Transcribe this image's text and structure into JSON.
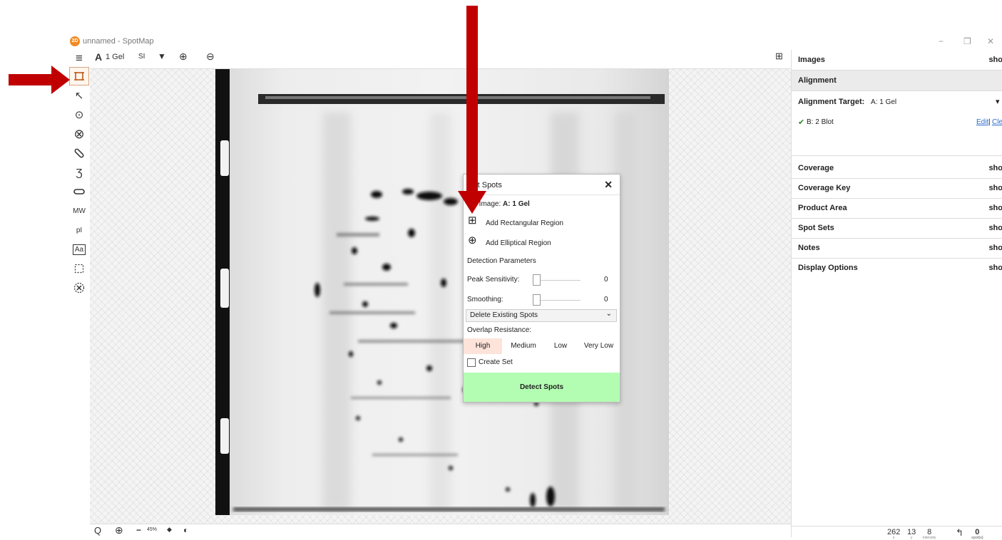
{
  "window": {
    "title": "unnamed - SpotMap",
    "app_icon_text": "2D",
    "controls": [
      "−",
      "❐",
      "✕"
    ]
  },
  "left_toolbar": {
    "items": [
      {
        "name": "rectangle-select-icon",
        "glyph": "⌑",
        "selected": true
      },
      {
        "name": "pointer-icon",
        "glyph": "↖"
      },
      {
        "name": "add-spot-icon",
        "glyph": "⊙"
      },
      {
        "name": "remove-spot-icon",
        "glyph": "⊗"
      },
      {
        "name": "link-icon",
        "glyph": "⊘"
      },
      {
        "name": "freeform-icon",
        "glyph": "Ʒ"
      },
      {
        "name": "band-icon",
        "glyph": "▭"
      },
      {
        "name": "mw-tool",
        "glyph": "MW"
      },
      {
        "name": "pi-tool",
        "glyph": "pI"
      },
      {
        "name": "text-tool",
        "glyph": "Aa"
      },
      {
        "name": "region-select-icon",
        "glyph": "⬚"
      },
      {
        "name": "delete-region-icon",
        "glyph": "⊗"
      }
    ]
  },
  "tabbar": {
    "menu_glyph": "≡",
    "image_letter": "A",
    "image_name": "1 Gel",
    "si_label": "SI",
    "filter_glyph": "▼",
    "zoom_in_glyph": "⊕",
    "zoom_out_glyph": "⊖",
    "expand_glyph": "⊞"
  },
  "bottombar": {
    "search_glyph": "Q",
    "zoom_glyph": "⊕",
    "minus_glyph": "−",
    "zoom_level": "45%",
    "diamond_glyph": "◆",
    "contrast_glyph": "◐"
  },
  "right_panel": {
    "images_label": "Images",
    "images_action": "sho",
    "alignment_label": "Alignment",
    "alignment_target_label": "Alignment Target:",
    "alignment_target_value": "A: 1 Gel",
    "alignment_dropdown": "▾",
    "aligned_check": "✔",
    "aligned_item": "B: 2 Blot",
    "edit_link": "Edit",
    "sep": "|",
    "clear_link": "Cle",
    "sections": [
      {
        "label": "Coverage",
        "action": "sho"
      },
      {
        "label": "Coverage Key",
        "action": "sho"
      },
      {
        "label": "Product Area",
        "action": "sho"
      },
      {
        "label": "Spot Sets",
        "action": "sho"
      },
      {
        "label": "Notes",
        "action": "sho"
      },
      {
        "label": "Display Options",
        "action": "sho"
      }
    ],
    "status": {
      "x_value": "262",
      "x_label": "x",
      "y_value": "13",
      "y_label": "y",
      "intensity_value": "8",
      "intensity_label": "intensity",
      "undo_glyph": "↰",
      "spots_value": "0",
      "spots_label": "spot(s)"
    }
  },
  "dialog": {
    "title": "ect Spots",
    "close": "✕",
    "source_label": "rce Image:",
    "source_value": "A: 1 Gel",
    "add_rect_glyph": "⊞",
    "add_rect": "Add Rectangular Region",
    "add_ellipse_glyph": "⊕",
    "add_ellipse": "Add Elliptical Region",
    "detection_params": "Detection Parameters",
    "peak_label": "Peak Sensitivity:",
    "peak_value": "0",
    "smoothing_label": "Smoothing:",
    "smoothing_value": "0",
    "existing_spots": "Delete Existing Spots",
    "existing_spots_arrow": "⌄",
    "overlap_label": "Overlap Resistance:",
    "overlap_options": [
      "High",
      "Medium",
      "Low",
      "Very Low"
    ],
    "overlap_selected": "High",
    "create_set": "Create Set",
    "detect_button": "Detect Spots"
  },
  "colors": {
    "accent_orange": "#f08a24",
    "arrow_red": "#c00000",
    "detect_green": "#b3fdb3",
    "overlap_selected_bg": "#fde3d9",
    "link_blue": "#2a6ccf"
  }
}
